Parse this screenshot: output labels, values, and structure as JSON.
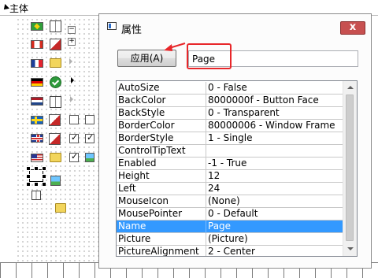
{
  "designer": {
    "title": "主体"
  },
  "window": {
    "title": "属性",
    "close_label": "x"
  },
  "toolbar": {
    "apply_label": "应用(A)",
    "name_value": "Page"
  },
  "annotation": {
    "color": "#e8272a"
  },
  "properties": [
    {
      "name": "AutoSize",
      "value": "0 - False"
    },
    {
      "name": "BackColor",
      "value": "8000000f - Button Face"
    },
    {
      "name": "BackStyle",
      "value": "0 - Transparent"
    },
    {
      "name": "BorderColor",
      "value": "80000006 - Window Frame"
    },
    {
      "name": "BorderStyle",
      "value": "1 - Single"
    },
    {
      "name": "ControlTipText",
      "value": ""
    },
    {
      "name": "Enabled",
      "value": "-1 - True"
    },
    {
      "name": "Height",
      "value": "12"
    },
    {
      "name": "Left",
      "value": "24"
    },
    {
      "name": "MouseIcon",
      "value": "(None)"
    },
    {
      "name": "MousePointer",
      "value": "0 - Default"
    },
    {
      "name": "Name",
      "value": "Page"
    },
    {
      "name": "Picture",
      "value": "(Picture)"
    },
    {
      "name": "PictureAlignment",
      "value": "2 - Center"
    }
  ],
  "selected_property": "Name",
  "colors": {
    "selection": "#3399ff",
    "close": "#c75050"
  },
  "icons": [
    "back-arrow-icon",
    "window-icon",
    "close-icon",
    "scroll-up-icon",
    "scroll-down-icon",
    "brazil-flag-icon",
    "canada-flag-icon",
    "france-flag-icon",
    "germany-flag-icon",
    "netherlands-flag-icon",
    "sweden-flag-icon",
    "uk-flag-icon",
    "usa-flag-icon"
  ]
}
